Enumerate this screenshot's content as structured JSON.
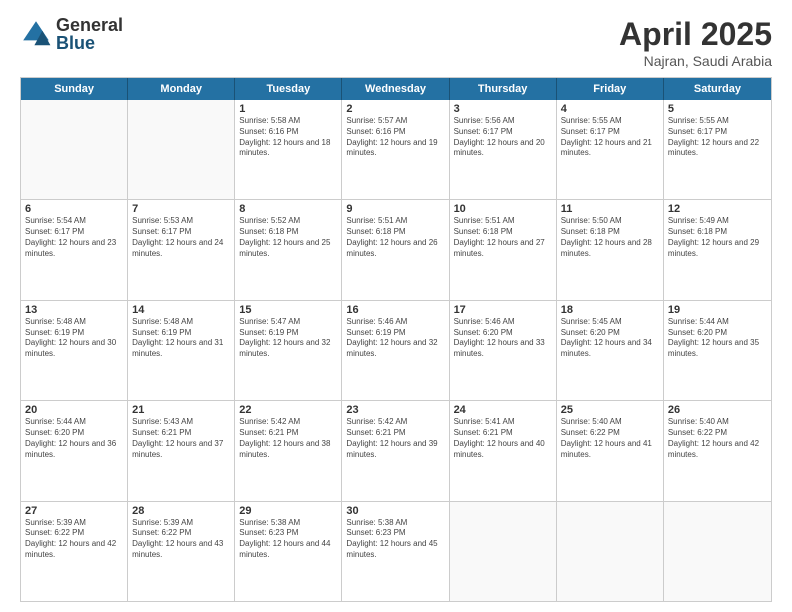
{
  "logo": {
    "general": "General",
    "blue": "Blue"
  },
  "title": {
    "month": "April 2025",
    "location": "Najran, Saudi Arabia"
  },
  "header_days": [
    "Sunday",
    "Monday",
    "Tuesday",
    "Wednesday",
    "Thursday",
    "Friday",
    "Saturday"
  ],
  "weeks": [
    [
      {
        "day": "",
        "info": ""
      },
      {
        "day": "",
        "info": ""
      },
      {
        "day": "1",
        "info": "Sunrise: 5:58 AM\nSunset: 6:16 PM\nDaylight: 12 hours and 18 minutes."
      },
      {
        "day": "2",
        "info": "Sunrise: 5:57 AM\nSunset: 6:16 PM\nDaylight: 12 hours and 19 minutes."
      },
      {
        "day": "3",
        "info": "Sunrise: 5:56 AM\nSunset: 6:17 PM\nDaylight: 12 hours and 20 minutes."
      },
      {
        "day": "4",
        "info": "Sunrise: 5:55 AM\nSunset: 6:17 PM\nDaylight: 12 hours and 21 minutes."
      },
      {
        "day": "5",
        "info": "Sunrise: 5:55 AM\nSunset: 6:17 PM\nDaylight: 12 hours and 22 minutes."
      }
    ],
    [
      {
        "day": "6",
        "info": "Sunrise: 5:54 AM\nSunset: 6:17 PM\nDaylight: 12 hours and 23 minutes."
      },
      {
        "day": "7",
        "info": "Sunrise: 5:53 AM\nSunset: 6:17 PM\nDaylight: 12 hours and 24 minutes."
      },
      {
        "day": "8",
        "info": "Sunrise: 5:52 AM\nSunset: 6:18 PM\nDaylight: 12 hours and 25 minutes."
      },
      {
        "day": "9",
        "info": "Sunrise: 5:51 AM\nSunset: 6:18 PM\nDaylight: 12 hours and 26 minutes."
      },
      {
        "day": "10",
        "info": "Sunrise: 5:51 AM\nSunset: 6:18 PM\nDaylight: 12 hours and 27 minutes."
      },
      {
        "day": "11",
        "info": "Sunrise: 5:50 AM\nSunset: 6:18 PM\nDaylight: 12 hours and 28 minutes."
      },
      {
        "day": "12",
        "info": "Sunrise: 5:49 AM\nSunset: 6:18 PM\nDaylight: 12 hours and 29 minutes."
      }
    ],
    [
      {
        "day": "13",
        "info": "Sunrise: 5:48 AM\nSunset: 6:19 PM\nDaylight: 12 hours and 30 minutes."
      },
      {
        "day": "14",
        "info": "Sunrise: 5:48 AM\nSunset: 6:19 PM\nDaylight: 12 hours and 31 minutes."
      },
      {
        "day": "15",
        "info": "Sunrise: 5:47 AM\nSunset: 6:19 PM\nDaylight: 12 hours and 32 minutes."
      },
      {
        "day": "16",
        "info": "Sunrise: 5:46 AM\nSunset: 6:19 PM\nDaylight: 12 hours and 32 minutes."
      },
      {
        "day": "17",
        "info": "Sunrise: 5:46 AM\nSunset: 6:20 PM\nDaylight: 12 hours and 33 minutes."
      },
      {
        "day": "18",
        "info": "Sunrise: 5:45 AM\nSunset: 6:20 PM\nDaylight: 12 hours and 34 minutes."
      },
      {
        "day": "19",
        "info": "Sunrise: 5:44 AM\nSunset: 6:20 PM\nDaylight: 12 hours and 35 minutes."
      }
    ],
    [
      {
        "day": "20",
        "info": "Sunrise: 5:44 AM\nSunset: 6:20 PM\nDaylight: 12 hours and 36 minutes."
      },
      {
        "day": "21",
        "info": "Sunrise: 5:43 AM\nSunset: 6:21 PM\nDaylight: 12 hours and 37 minutes."
      },
      {
        "day": "22",
        "info": "Sunrise: 5:42 AM\nSunset: 6:21 PM\nDaylight: 12 hours and 38 minutes."
      },
      {
        "day": "23",
        "info": "Sunrise: 5:42 AM\nSunset: 6:21 PM\nDaylight: 12 hours and 39 minutes."
      },
      {
        "day": "24",
        "info": "Sunrise: 5:41 AM\nSunset: 6:21 PM\nDaylight: 12 hours and 40 minutes."
      },
      {
        "day": "25",
        "info": "Sunrise: 5:40 AM\nSunset: 6:22 PM\nDaylight: 12 hours and 41 minutes."
      },
      {
        "day": "26",
        "info": "Sunrise: 5:40 AM\nSunset: 6:22 PM\nDaylight: 12 hours and 42 minutes."
      }
    ],
    [
      {
        "day": "27",
        "info": "Sunrise: 5:39 AM\nSunset: 6:22 PM\nDaylight: 12 hours and 42 minutes."
      },
      {
        "day": "28",
        "info": "Sunrise: 5:39 AM\nSunset: 6:22 PM\nDaylight: 12 hours and 43 minutes."
      },
      {
        "day": "29",
        "info": "Sunrise: 5:38 AM\nSunset: 6:23 PM\nDaylight: 12 hours and 44 minutes."
      },
      {
        "day": "30",
        "info": "Sunrise: 5:38 AM\nSunset: 6:23 PM\nDaylight: 12 hours and 45 minutes."
      },
      {
        "day": "",
        "info": ""
      },
      {
        "day": "",
        "info": ""
      },
      {
        "day": "",
        "info": ""
      }
    ]
  ]
}
